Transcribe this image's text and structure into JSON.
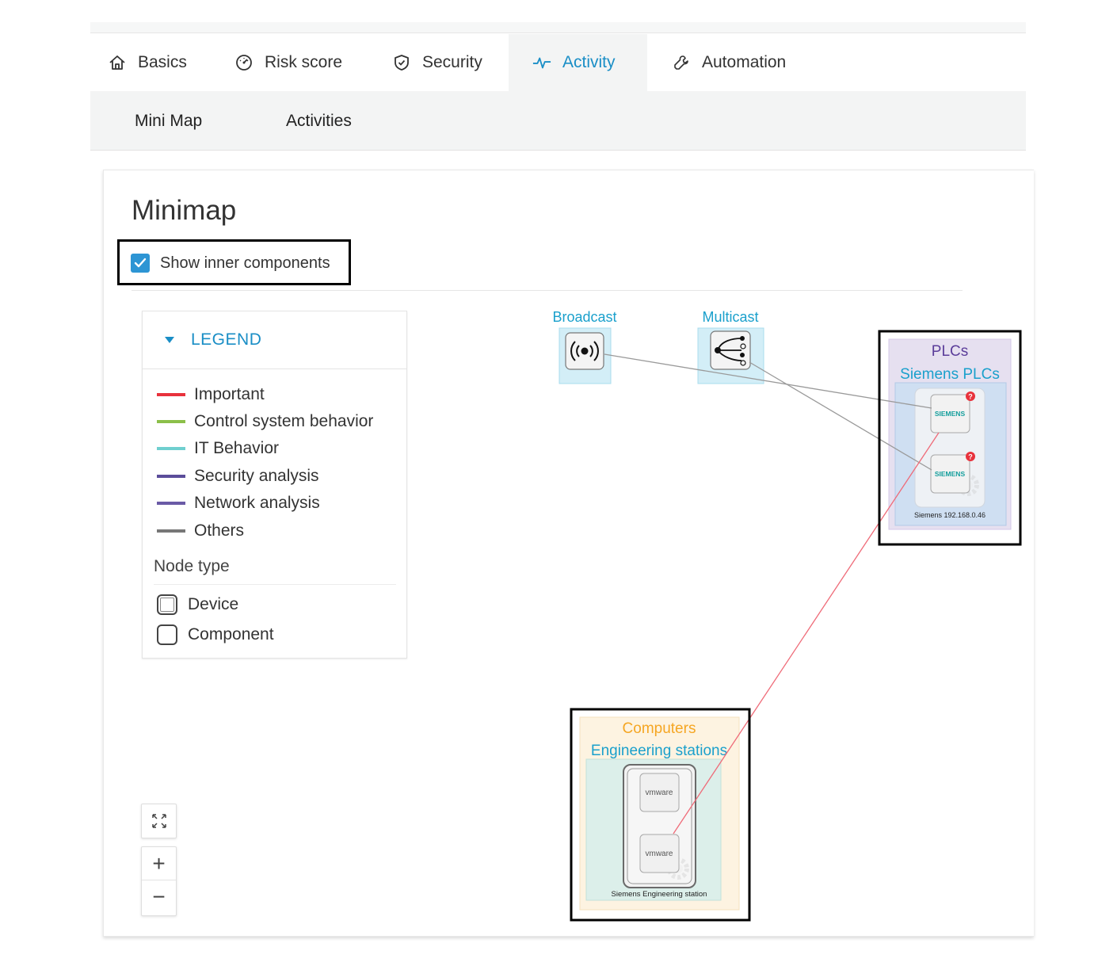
{
  "tabs": [
    {
      "label": "Basics",
      "icon": "home-icon"
    },
    {
      "label": "Risk score",
      "icon": "gauge-icon"
    },
    {
      "label": "Security",
      "icon": "shield-icon"
    },
    {
      "label": "Activity",
      "icon": "activity-pulse-icon",
      "active": true
    },
    {
      "label": "Automation",
      "icon": "wrench-icon"
    }
  ],
  "subnav": [
    {
      "label": "Mini Map"
    },
    {
      "label": "Activities"
    }
  ],
  "minimap": {
    "title": "Minimap",
    "show_inner_label": "Show inner components",
    "show_inner_checked": true
  },
  "legend": {
    "header": "LEGEND",
    "items": [
      {
        "label": "Important",
        "color": "#e8323c"
      },
      {
        "label": "Control system behavior",
        "color": "#8cbf4a"
      },
      {
        "label": "IT Behavior",
        "color": "#6fcfcf"
      },
      {
        "label": "Security analysis",
        "color": "#5b4d9a"
      },
      {
        "label": "Network analysis",
        "color": "#6a5aa6"
      },
      {
        "label": "Others",
        "color": "#777777"
      }
    ],
    "node_type_title": "Node type",
    "node_types": [
      {
        "label": "Device"
      },
      {
        "label": "Component"
      }
    ]
  },
  "graph": {
    "broadcast_label": "Broadcast",
    "multicast_label": "Multicast",
    "plc_group_label": "PLCs",
    "plc_subgroup_label": "Siemens PLCs",
    "plc_component_text": "SIEMENS",
    "plc_badge": "?",
    "plc_device_label": "Siemens 192.168.0.46",
    "computers_group_label": "Computers",
    "engineering_subgroup_label": "Engineering stations",
    "vm_component_text": "vmware",
    "engineering_device_label": "Siemens Engineering station",
    "colors": {
      "broadcast_fill": "#d3eef7",
      "plc_group_fill": "#e6e0f0",
      "plc_subgroup_fill": "#cfdff2",
      "computers_fill": "#fdf3e1",
      "engineering_fill": "#dcefea",
      "important_link": "#ef6b78",
      "other_link": "#9a9a9a"
    }
  },
  "zoom": {
    "fit_icon": "fit-screen-icon",
    "zoom_in_icon": "plus-icon",
    "zoom_out_icon": "minus-icon",
    "zoom_in_glyph": "+",
    "zoom_out_glyph": "−"
  }
}
